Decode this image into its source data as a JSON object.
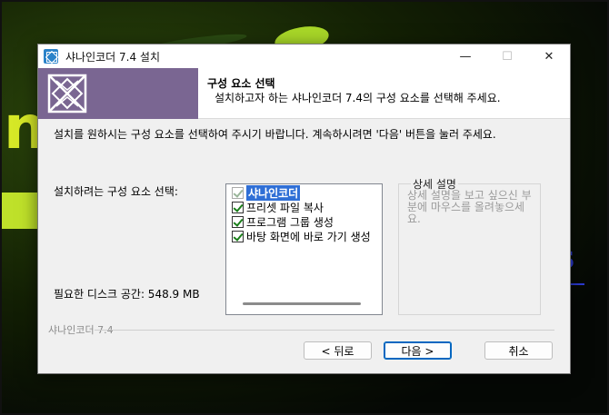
{
  "window": {
    "title": "샤나인코더 7.4 설치",
    "controls": {
      "minimize": "—",
      "maximize": "☐",
      "close": "✕"
    }
  },
  "header": {
    "title": "구성 요소 선택",
    "subtitle": "설치하고자 하는 샤나인코더 7.4의 구성 요소를 선택해 주세요."
  },
  "body": {
    "description": "설치를 원하시는 구성 요소를 선택하여 주시기 바랍니다. 계속하시려면 '다음' 버튼을 눌러 주세요.",
    "select_label": "설치하려는 구성 요소 선택:",
    "disk_space": "필요한 디스크 공간: 548.9 MB"
  },
  "components": [
    {
      "label": "샤나인코더",
      "checked": true,
      "disabled": true,
      "selected": true
    },
    {
      "label": "프리셋 파일 복사",
      "checked": true,
      "disabled": false,
      "selected": false
    },
    {
      "label": "프로그램 그룹 생성",
      "checked": true,
      "disabled": false,
      "selected": false
    },
    {
      "label": "바탕 화면에 바로 가기 생성",
      "checked": true,
      "disabled": false,
      "selected": false
    }
  ],
  "description_panel": {
    "title": "상세 설명",
    "body": "상세 설명을 보고 싶으신 부분에 마우스를 올려놓으세요."
  },
  "footer": {
    "brand": "샤나인코더 7.4",
    "back": "< 뒤로",
    "next": "다음 >",
    "cancel": "취소"
  },
  "colors": {
    "header_logo_bg": "#7a6692",
    "selection": "#2f6fd6",
    "primary_button_border": "#0067c0"
  },
  "icons": {
    "app": "installer-app-icon",
    "header_logo": "shana-logo-icon"
  }
}
